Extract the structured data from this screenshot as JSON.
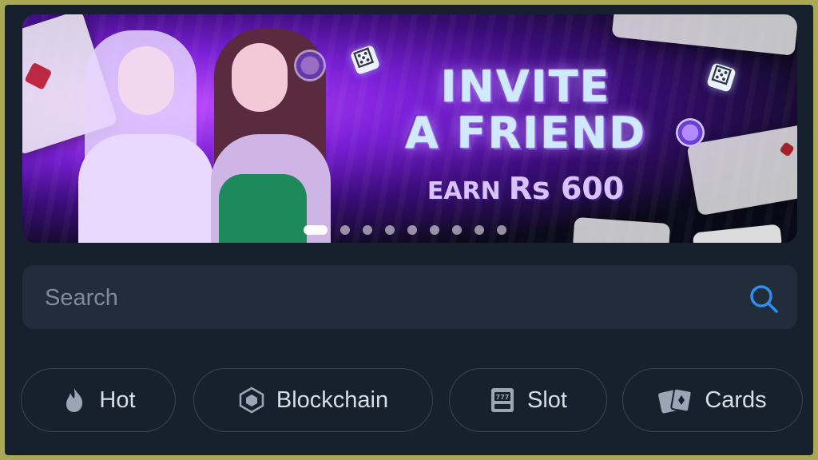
{
  "banner": {
    "headline_line1": "INVITE",
    "headline_line2": "A FRIEND",
    "earn_label": "EARN",
    "earn_amount": "Rs 600",
    "slide_count": 9,
    "active_slide": 1
  },
  "search": {
    "placeholder": "Search",
    "value": "",
    "icon": "search-icon"
  },
  "categories": [
    {
      "label": "Hot",
      "icon": "fire-icon"
    },
    {
      "label": "Blockchain",
      "icon": "cube-icon"
    },
    {
      "label": "Slot",
      "icon": "slot-machine-icon"
    },
    {
      "label": "Cards",
      "icon": "playing-cards-icon"
    }
  ],
  "colors": {
    "background": "#17212e",
    "surface": "#212d3b",
    "accent": "#2f8ff0",
    "outer_border": "#a9a955"
  }
}
